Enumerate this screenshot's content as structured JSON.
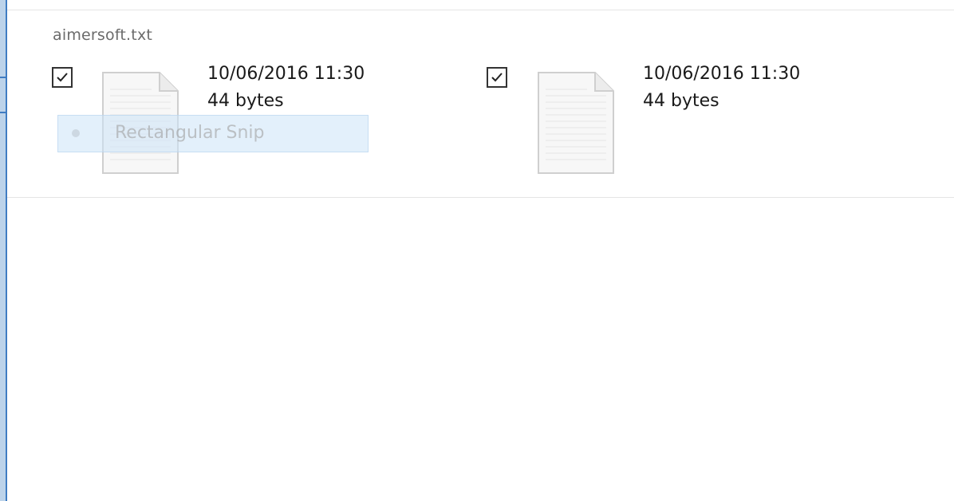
{
  "group": {
    "title": "aimersoft.txt"
  },
  "files": [
    {
      "checked": true,
      "date": "10/06/2016 11:30",
      "size": "44 bytes",
      "icon": "text-file-icon"
    },
    {
      "checked": true,
      "date": "10/06/2016 11:30",
      "size": "44 bytes",
      "icon": "text-file-icon"
    }
  ],
  "snip_menu": {
    "label": "Rectangular Snip",
    "icon": "snip-mode-icon"
  },
  "colors": {
    "accent": "#3f7cc2",
    "snip_highlight": "#cce4f7"
  }
}
